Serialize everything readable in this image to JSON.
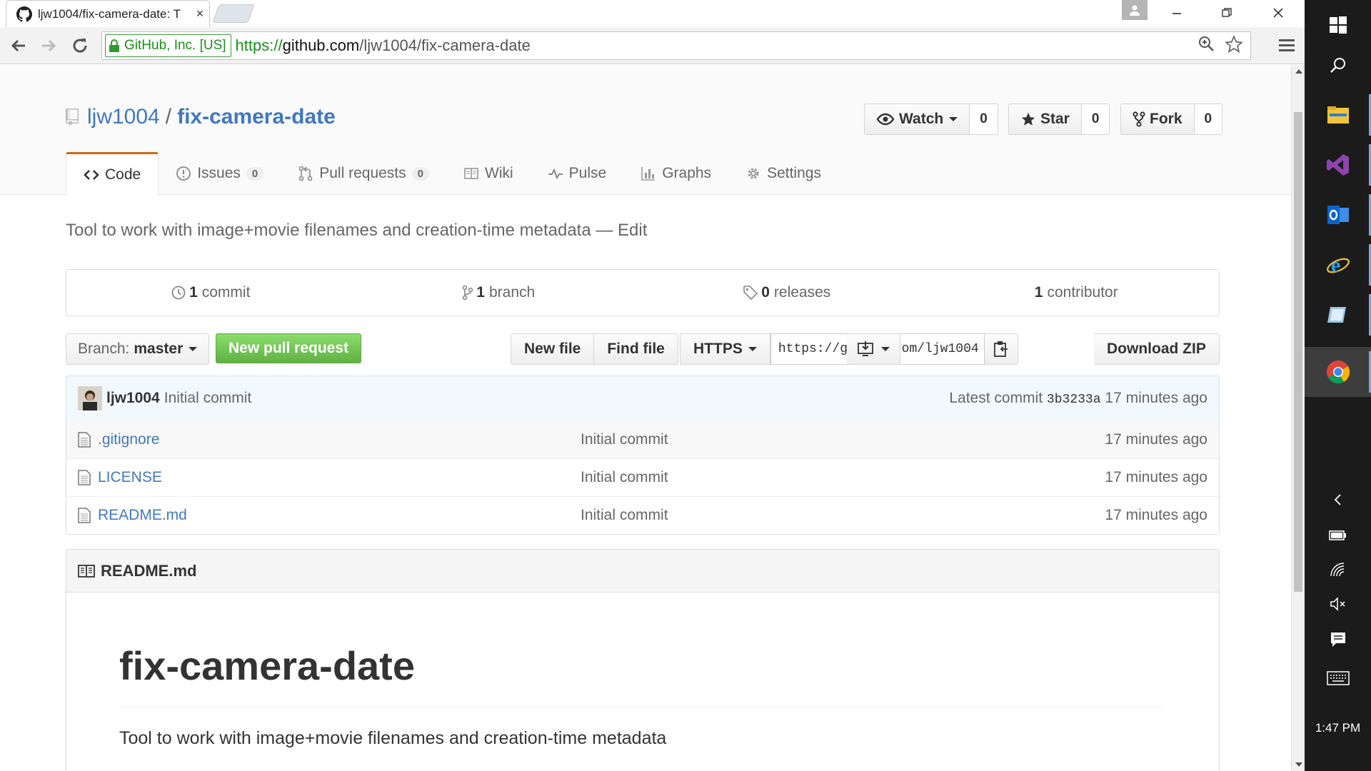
{
  "browser": {
    "tab_title": "ljw1004/fix-camera-date: T",
    "tab_close": "×",
    "secure_label": "GitHub, Inc. [US]",
    "url_scheme": "https://",
    "url_host": "github.com",
    "url_path": "/ljw1004/fix-camera-date",
    "window_controls": [
      "minimize-icon",
      "restore-icon",
      "close-icon"
    ]
  },
  "repo": {
    "owner": "ljw1004",
    "separator": "/",
    "name": "fix-camera-date",
    "watch_label": "Watch",
    "watch_count": "0",
    "star_label": "Star",
    "star_count": "0",
    "fork_label": "Fork",
    "fork_count": "0"
  },
  "nav": {
    "code": "Code",
    "issues": "Issues",
    "issues_count": "0",
    "pulls": "Pull requests",
    "pulls_count": "0",
    "wiki": "Wiki",
    "pulse": "Pulse",
    "graphs": "Graphs",
    "settings": "Settings"
  },
  "description": {
    "text": "Tool to work with image+movie filenames and creation-time metadata",
    "dash": " — ",
    "edit": "Edit"
  },
  "numbers": {
    "commits_count": "1",
    "commits_label": "commit",
    "branches_count": "1",
    "branches_label": "branch",
    "releases_count": "0",
    "releases_label": "releases",
    "contributors_count": "1",
    "contributors_label": "contributor"
  },
  "file_nav": {
    "branch_prefix": "Branch:",
    "branch_name": "master",
    "new_pr": "New pull request",
    "new_file": "New file",
    "find_file": "Find file",
    "protocol": "HTTPS",
    "clone_url": "https://github.com/ljw1004",
    "download_zip": "Download ZIP"
  },
  "commit": {
    "author": "ljw1004",
    "message": "Initial commit",
    "latest_label": "Latest commit",
    "sha": "3b3233a",
    "age": "17 minutes ago"
  },
  "files": [
    {
      "name": ".gitignore",
      "message": "Initial commit",
      "age": "17 minutes ago"
    },
    {
      "name": "LICENSE",
      "message": "Initial commit",
      "age": "17 minutes ago"
    },
    {
      "name": "README.md",
      "message": "Initial commit",
      "age": "17 minutes ago"
    }
  ],
  "readme": {
    "header": "README.md",
    "title": "fix-camera-date",
    "body": "Tool to work with image+movie filenames and creation-time metadata"
  },
  "taskbar": {
    "clock": "1:47 PM",
    "apps": [
      "windows-start-icon",
      "search-icon",
      "file-explorer-icon",
      "visual-studio-icon",
      "outlook-icon",
      "internet-explorer-icon",
      "app-icon",
      "chrome-icon"
    ],
    "tray": [
      "chevron-left-icon",
      "battery-icon",
      "wifi-icon",
      "volume-muted-icon",
      "notifications-icon",
      "keyboard-icon"
    ]
  },
  "colors": {
    "link": "#4078c0",
    "green_button": "#60b044",
    "selected_tab_accent": "#d26911",
    "commit_tease_bg": "#f2f9fc",
    "taskbar": "#1b1b1b"
  }
}
